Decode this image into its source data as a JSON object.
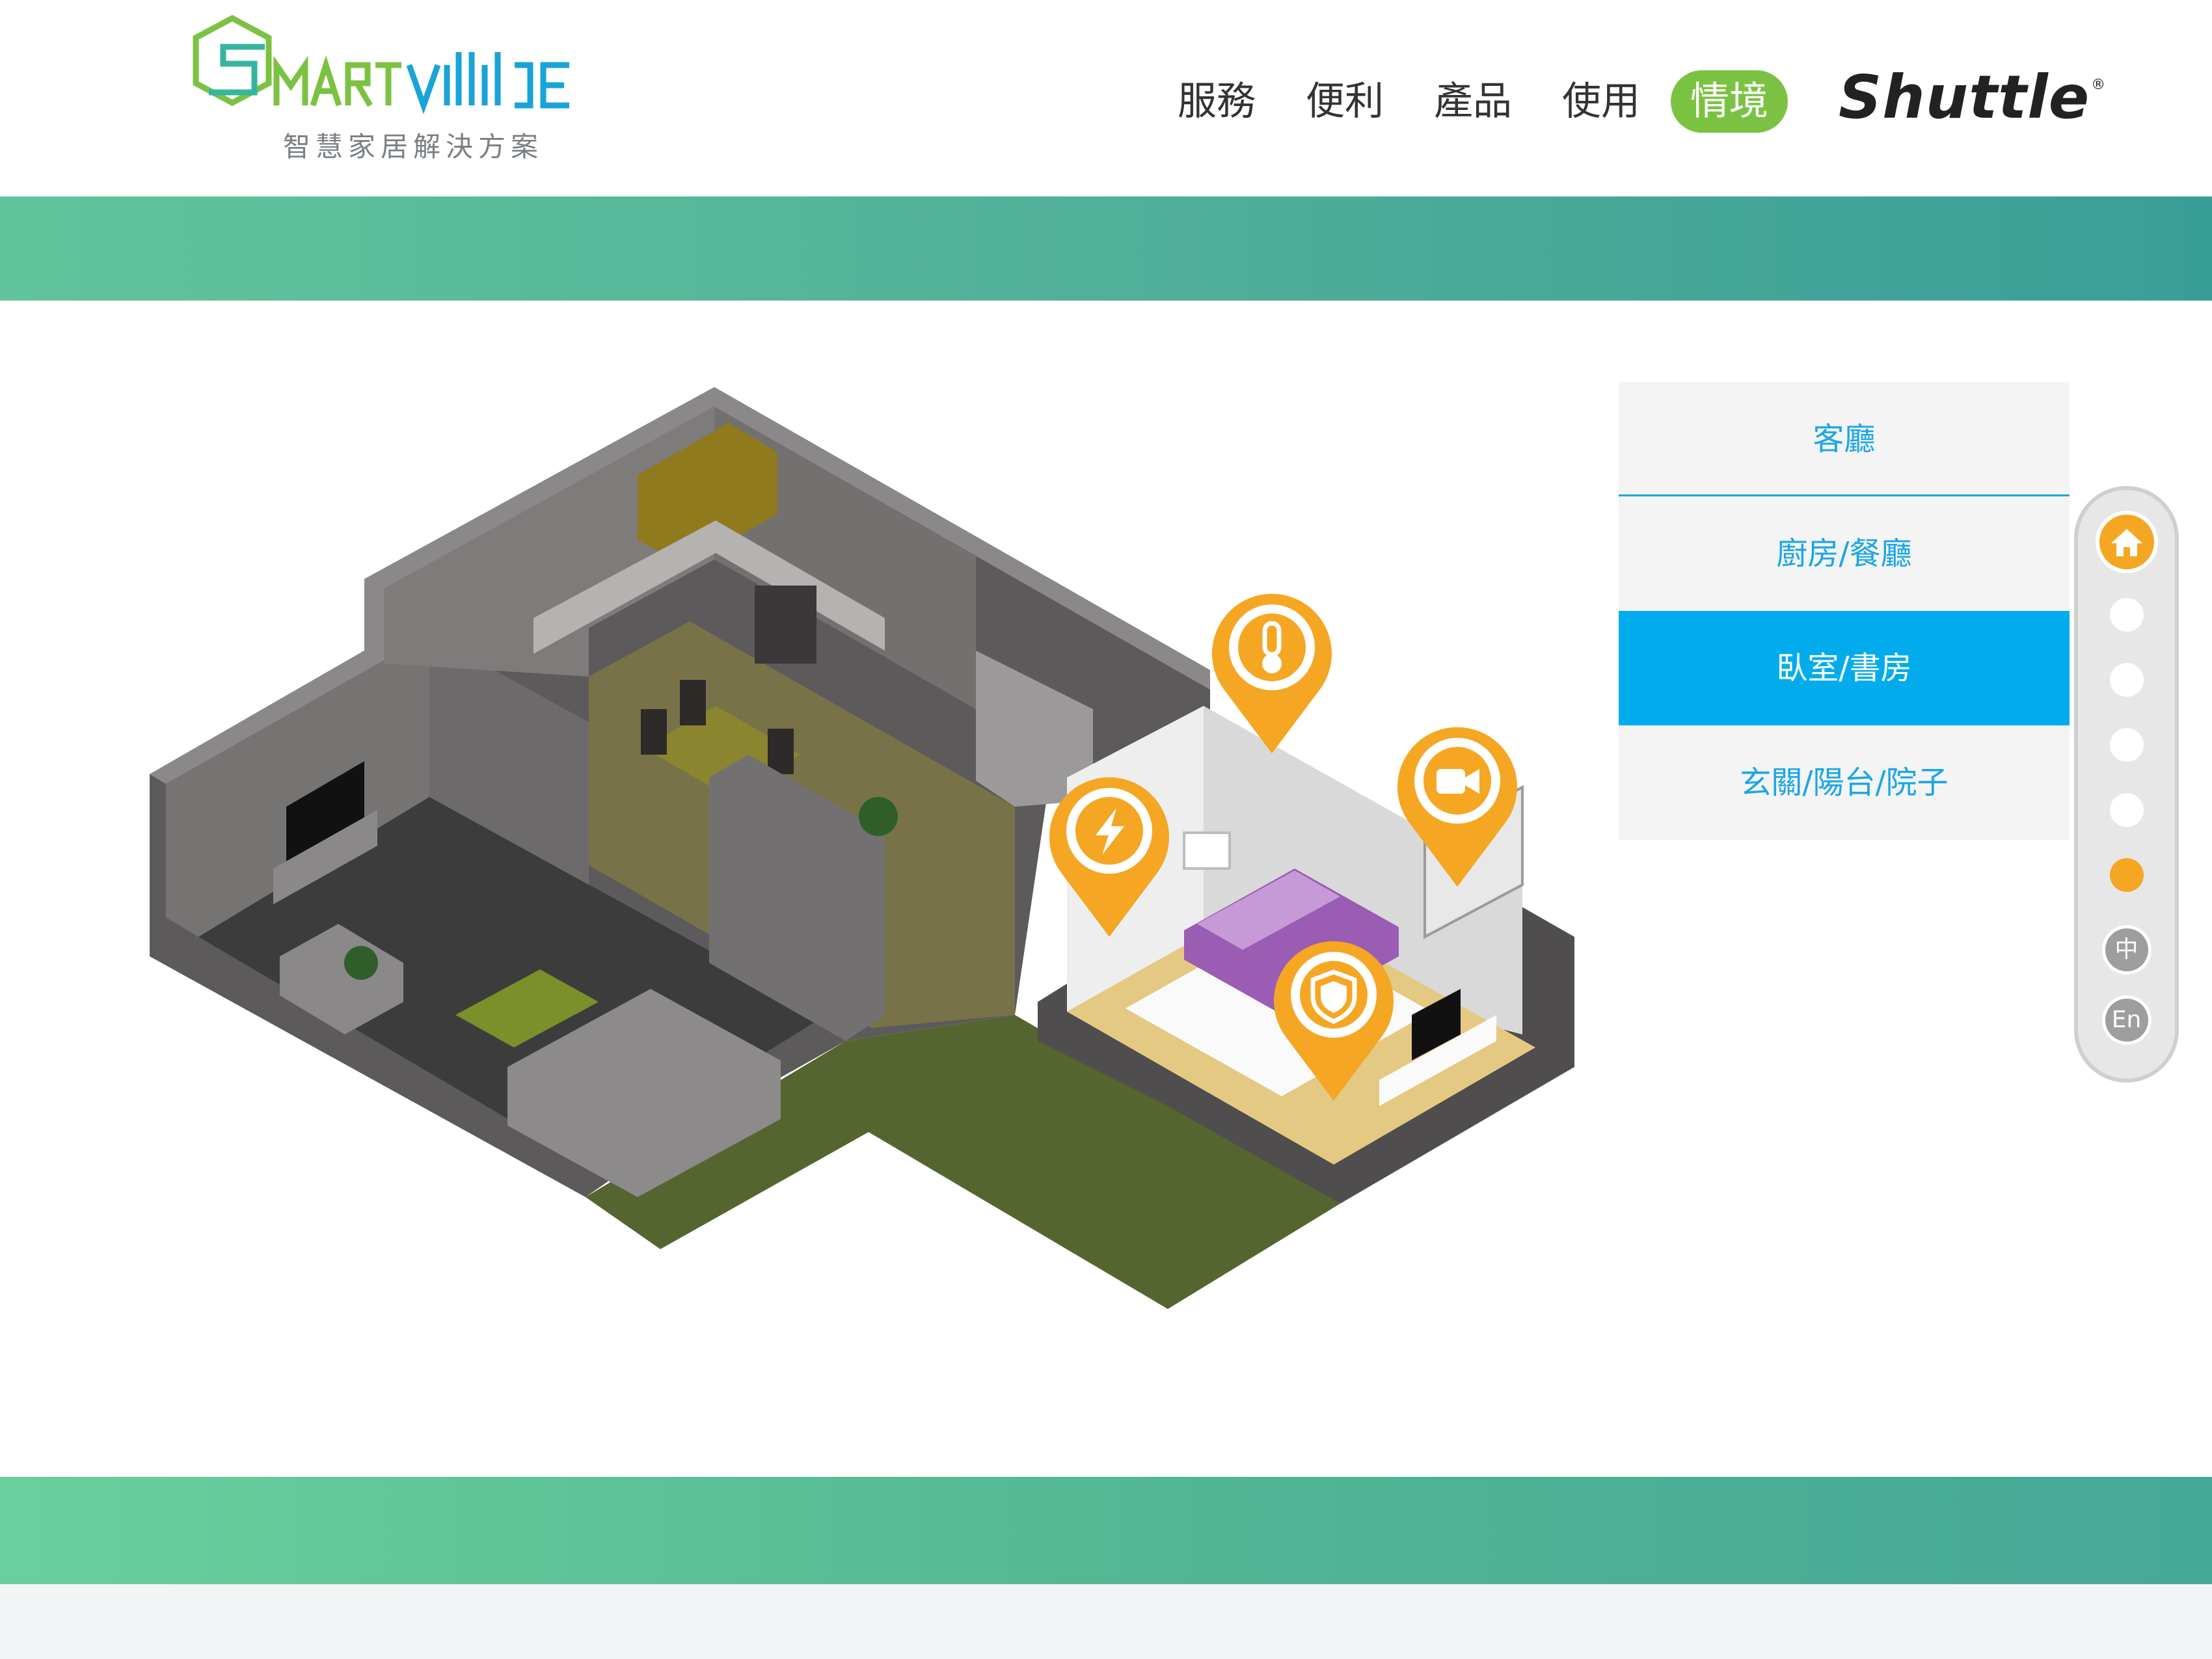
{
  "header": {
    "logo_text": "SMARTville",
    "tagline": "智慧家居解決方案",
    "nav": [
      {
        "label": "服務",
        "active": false
      },
      {
        "label": "便利",
        "active": false
      },
      {
        "label": "產品",
        "active": false
      },
      {
        "label": "使用",
        "active": false
      },
      {
        "label": "情境",
        "active": true
      }
    ],
    "brand": "Shuttle",
    "brand_mark": "®"
  },
  "scene": {
    "hotspots": [
      "power-icon",
      "thermometer-icon",
      "camera-icon",
      "shield-icon"
    ],
    "accent_color": "#f5a623"
  },
  "room_menu": [
    {
      "label": "客廳",
      "active": false
    },
    {
      "label": "廚房/餐廳",
      "active": false
    },
    {
      "label": "臥室/書房",
      "active": true
    },
    {
      "label": "玄關/陽台/院子",
      "active": false
    }
  ],
  "pager": {
    "home_icon": "home-icon",
    "dots": [
      false,
      false,
      false,
      false,
      true
    ],
    "languages": [
      "中",
      "En"
    ]
  },
  "colors": {
    "nav_active": "#7cc242",
    "menu_active": "#02acec",
    "menu_text": "#1ba6e6",
    "band": "#4fae98"
  }
}
